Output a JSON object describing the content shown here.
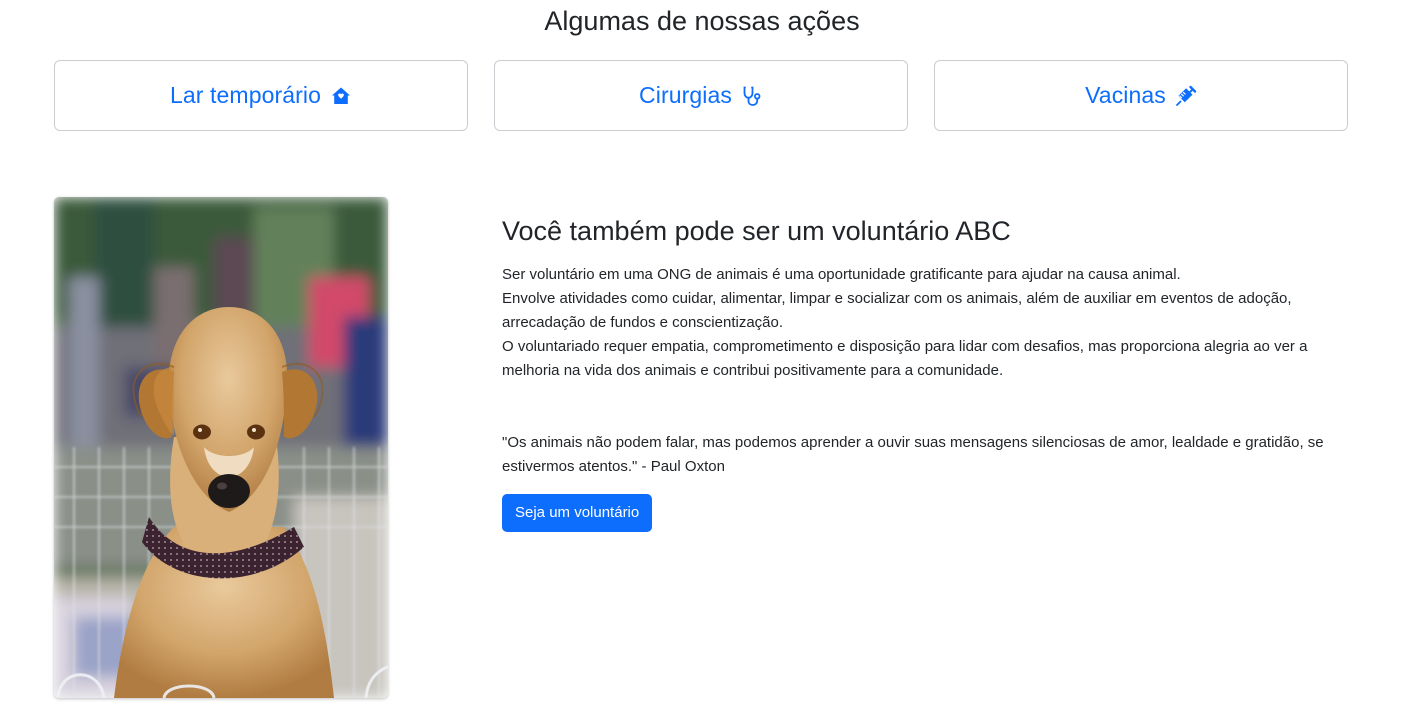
{
  "actions": {
    "title": "Algumas de nossas ações",
    "cards": [
      {
        "label": "Lar temporário",
        "icon": "house-icon"
      },
      {
        "label": "Cirurgias",
        "icon": "stethoscope-icon"
      },
      {
        "label": "Vacinas",
        "icon": "syringe-icon"
      }
    ]
  },
  "volunteer": {
    "heading": "Você também pode ser um voluntário ABC",
    "description_lines": [
      "Ser voluntário em uma ONG de animais é uma oportunidade gratificante para ajudar na causa animal.",
      "Envolve atividades como cuidar, alimentar, limpar e socializar com os animais, além de auxiliar em eventos de adoção, arrecadação de fundos e conscientização.",
      "O voluntariado requer empatia, comprometimento e disposição para lidar com desafios, mas proporciona alegria ao ver a melhoria na vida dos animais e contribui positivamente para a comunidade."
    ],
    "quote": "\"Os animais não podem falar, mas podemos aprender a ouvir suas mensagens silenciosas de amor, lealdade e gratidão, se estivermos atentos.\" - Paul Oxton",
    "button_label": "Seja um voluntário",
    "image": "dog-with-bandana-photo"
  },
  "colors": {
    "accent": "#0d6efd",
    "text": "#212529",
    "border": "#c9cdd1"
  }
}
